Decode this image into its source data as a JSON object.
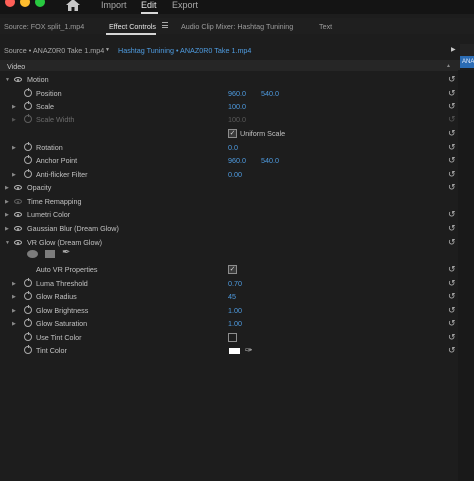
{
  "colors": {
    "accent_blue": "#4e9be0",
    "tab_blue": "#2b6cb4",
    "traffic_red": "#ff5f57",
    "traffic_yellow": "#febc2e",
    "traffic_green": "#28c840"
  },
  "topnav": {
    "import": "Import",
    "edit": "Edit",
    "export": "Export",
    "home_icon": "home-icon"
  },
  "panel_tabs": {
    "source": "Source: FOX split_1.mp4",
    "effect_controls": "Effect Controls",
    "audio_mixer": "Audio Clip Mixer: Hashtag Tunining",
    "text": "Text"
  },
  "source_bar": {
    "source": "Source • ANAZ0R0 Take 1.mp4",
    "sequence": "Hashtag Tunining • ANAZ0R0 Take 1.mp4",
    "timeline_tab": "ANA"
  },
  "section": "Video",
  "effects": {
    "motion": "Motion",
    "position": {
      "label": "Position",
      "x": "960.0",
      "y": "540.0"
    },
    "scale": {
      "label": "Scale",
      "value": "100.0"
    },
    "scale_width": {
      "label": "Scale Width",
      "value": "100.0"
    },
    "uniform_scale": "Uniform Scale",
    "rotation": {
      "label": "Rotation",
      "value": "0.0"
    },
    "anchor": {
      "label": "Anchor Point",
      "x": "960.0",
      "y": "540.0"
    },
    "antiflicker": {
      "label": "Anti-flicker Filter",
      "value": "0.00"
    },
    "opacity": "Opacity",
    "time_remap": "Time Remapping",
    "lumetri": "Lumetri Color",
    "gaussian": "Gaussian Blur (Dream Glow)",
    "vr_glow": "VR Glow (Dream Glow)",
    "auto_vr": "Auto VR Properties",
    "luma": {
      "label": "Luma Threshold",
      "value": "0.70"
    },
    "radius": {
      "label": "Glow Radius",
      "value": "45"
    },
    "brightness": {
      "label": "Glow Brightness",
      "value": "1.00"
    },
    "saturation": {
      "label": "Glow Saturation",
      "value": "1.00"
    },
    "use_tint": "Use Tint Color",
    "tint": "Tint Color",
    "tint_value": "#ffffff"
  }
}
